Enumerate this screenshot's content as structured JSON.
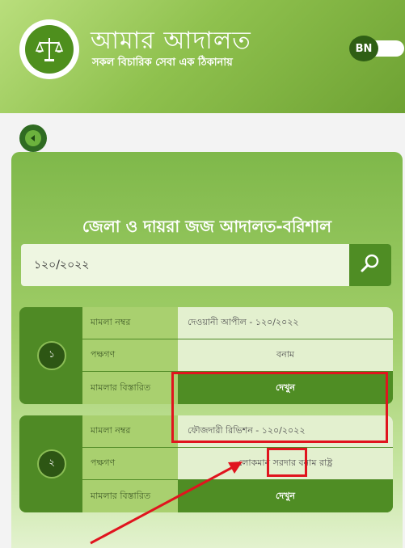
{
  "header": {
    "app_title": "আমার আদালত",
    "app_subtitle": "সকল বিচারিক সেবা এক ঠিকানায়",
    "language_label": "BN"
  },
  "court": {
    "title": "জেলা ও দায়রা জজ আদালত-বরিশাল"
  },
  "search": {
    "value": "১২০/২০২২",
    "placeholder": ""
  },
  "results": [
    {
      "serial": "১",
      "rows": [
        {
          "label": "মামলা নম্বর",
          "value": "দেওয়ানী আপীল - ১২০/২০২২"
        },
        {
          "label": "পক্ষগণ",
          "value": "বনাম"
        },
        {
          "label": "মামলার বিস্তারিত",
          "value": "দেখুন"
        }
      ]
    },
    {
      "serial": "২",
      "rows": [
        {
          "label": "মামলা নম্বর",
          "value": "ফৌজদারী রিভিশন - ১২০/২০২২"
        },
        {
          "label": "পক্ষগণ",
          "value": "লোকমান সরদার বনাম রাষ্ট্র"
        },
        {
          "label": "মামলার বিস্তারিত",
          "value": "দেখুন"
        }
      ]
    }
  ],
  "icons": {
    "logo": "scales-of-justice-icon",
    "back": "back-arrow-icon",
    "search": "search-icon"
  },
  "colors": {
    "brand_green": "#4f8d24",
    "dark_green": "#2f6b22",
    "annotation_red": "#e0141e"
  }
}
